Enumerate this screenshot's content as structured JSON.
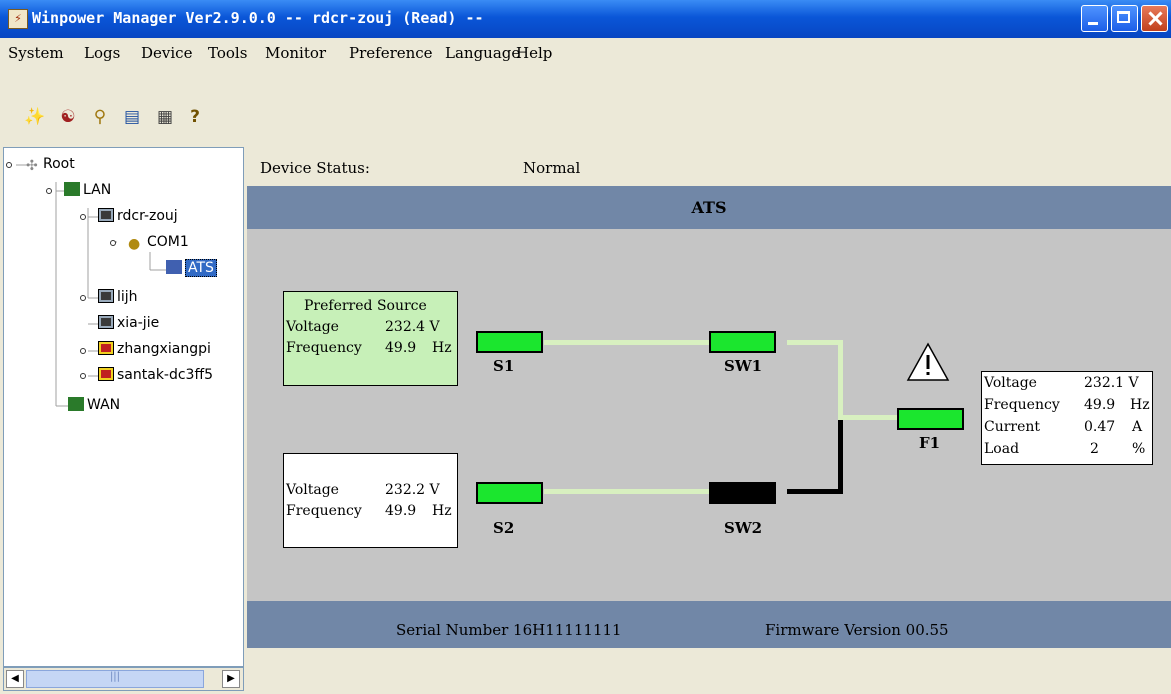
{
  "window": {
    "title": "Winpower Manager Ver2.9.0.0 -- rdcr-zouj (Read) --"
  },
  "menu": [
    "System",
    "Logs",
    "Device",
    "Tools",
    "Monitor",
    "Preference",
    "Language",
    "Help"
  ],
  "toolbar": {
    "icons": [
      "hammer-icon",
      "network-settings-icon",
      "lock-icon",
      "window-list-icon",
      "calculator-icon",
      "help-icon"
    ]
  },
  "tree": {
    "root": "Root",
    "lan": "LAN",
    "host1": "rdcr-zouj",
    "com": "COM1",
    "device": "ATS",
    "host2": "lijh",
    "host3": "xia-jie",
    "host4": "zhangxiangpi",
    "host5": "santak-dc3ff5",
    "wan": "WAN"
  },
  "status": {
    "label": "Device Status:",
    "value": "Normal"
  },
  "panel": {
    "title": "ATS"
  },
  "source1": {
    "header": "Preferred Source",
    "voltage_label": "Voltage",
    "voltage": "232.4 V",
    "freq_label": "Frequency",
    "freq": "49.9",
    "freq_unit": "Hz"
  },
  "source2": {
    "voltage_label": "Voltage",
    "voltage": "232.2 V",
    "freq_label": "Frequency",
    "freq": "49.9",
    "freq_unit": "Hz"
  },
  "switches": {
    "s1": "S1",
    "s2": "S2",
    "sw1": "SW1",
    "sw2": "SW2",
    "f1": "F1"
  },
  "switch_states": {
    "s1": "on",
    "s2": "on",
    "sw1": "on",
    "sw2": "off",
    "f1": "on"
  },
  "output": {
    "voltage_label": "Voltage",
    "voltage": "232.1 V",
    "freq_label": "Frequency",
    "freq": "49.9",
    "freq_unit": "Hz",
    "current_label": "Current",
    "current": "0.47",
    "current_unit": "A",
    "load_label": "Load",
    "load": "2",
    "load_unit": "%"
  },
  "footer": {
    "serial": "Serial Number 16H11111111",
    "firmware": "Firmware Version 00.55"
  },
  "colors": {
    "active": "#1be62e",
    "inactive": "#000000",
    "panel_header": "#7187a7",
    "diagram_bg": "#c5c5c5",
    "source_box": "#c7f0b8",
    "line_on": "#d8f0c0"
  }
}
